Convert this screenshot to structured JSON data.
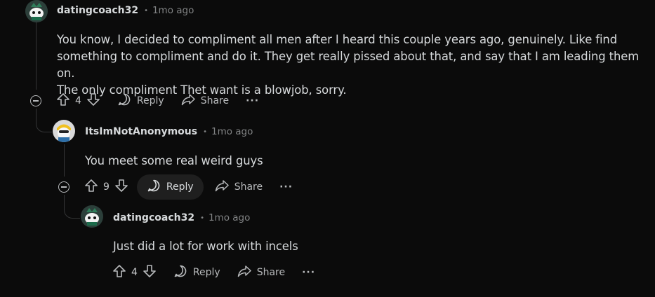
{
  "comments": [
    {
      "username": "datingcoach32",
      "time": "1mo ago",
      "body_lines": [
        "You know, I decided to compliment all men after I heard this couple years ago, genuinely. Like find",
        "something to compliment and do it. They get really pissed about that, and say that I am leading them on.",
        "The only compliment Thet want is a blowjob, sorry."
      ],
      "score": "4",
      "reply_label": "Reply",
      "share_label": "Share",
      "more_label": "···"
    },
    {
      "username": "ItsImNotAnonymous",
      "time": "1mo ago",
      "body": "You meet some real weird guys",
      "score": "9",
      "reply_label": "Reply",
      "share_label": "Share",
      "more_label": "···"
    },
    {
      "username": "datingcoach32",
      "time": "1mo ago",
      "body": "Just did a lot for work with incels",
      "score": "4",
      "reply_label": "Reply",
      "share_label": "Share",
      "more_label": "···"
    }
  ],
  "separator": "•",
  "colors": {
    "background": "#0b0b0b",
    "text": "#d7dadc",
    "muted": "#818384",
    "thread": "#343536"
  },
  "icons": [
    "avatar-snoo",
    "upvote-icon",
    "downvote-icon",
    "comment-bubble-icon",
    "share-arrow-icon",
    "collapse-icon"
  ]
}
